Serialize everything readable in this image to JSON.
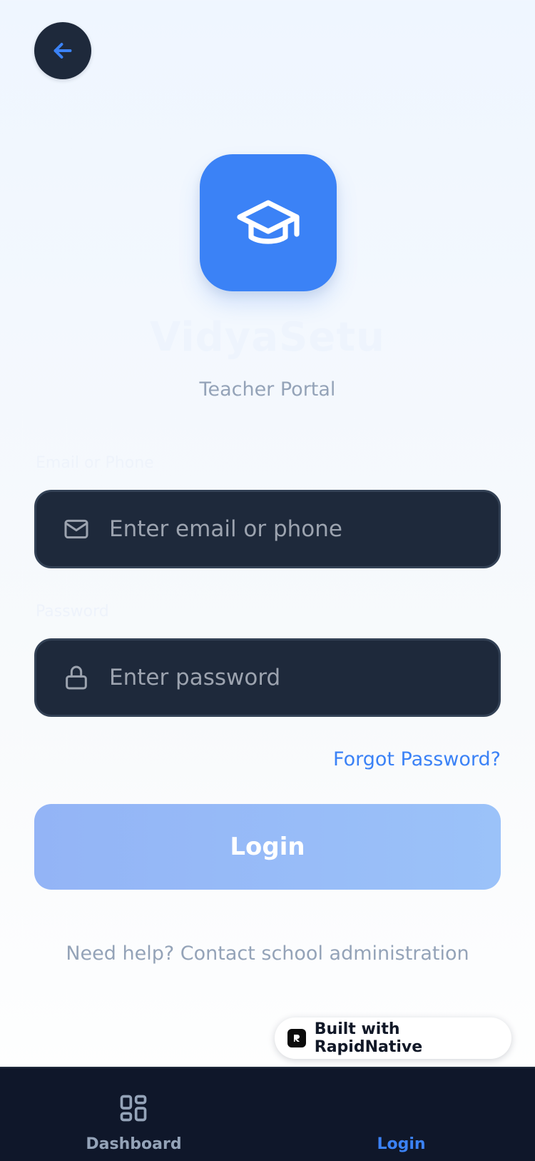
{
  "header": {
    "back_icon": "arrow-left-icon"
  },
  "brand": {
    "logo_icon": "graduation-cap-icon",
    "app_name": "VidyaSetu",
    "subtitle": "Teacher Portal"
  },
  "form": {
    "email_label": "Email or Phone",
    "email_placeholder": "Enter email or phone",
    "email_icon": "mail-icon",
    "password_label": "Password",
    "password_placeholder": "Enter password",
    "password_icon": "lock-icon",
    "forgot_label": "Forgot Password?",
    "login_label": "Login"
  },
  "help_text": "Need help? Contact school administration",
  "badge": {
    "label": "Built with RapidNative"
  },
  "tabbar": {
    "tabs": [
      {
        "label": "Dashboard",
        "icon": "dashboard-grid-icon",
        "active": false
      },
      {
        "label": "Login",
        "icon": "login-icon",
        "active": true
      }
    ]
  },
  "colors": {
    "accent": "#3b82f6",
    "dark_surface": "#1e293b",
    "tabbar_bg": "#0f172a",
    "muted_text": "#94a3b8"
  }
}
